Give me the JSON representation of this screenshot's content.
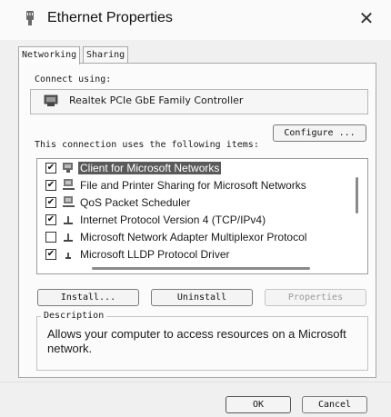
{
  "window": {
    "title": "Ethernet Properties",
    "close_glyph": "✕"
  },
  "tabs": [
    {
      "label": "Networking",
      "active": true
    },
    {
      "label": "Sharing",
      "active": false
    }
  ],
  "connect_using": {
    "label": "Connect using:",
    "adapter": "Realtek PCIe GbE Family Controller",
    "icon": "network-adapter-icon"
  },
  "buttons": {
    "configure": "Configure ...",
    "install": "Install...",
    "uninstall": "Uninstall",
    "properties": "Properties",
    "ok": "OK",
    "cancel": "Cancel"
  },
  "items_label": "This connection uses the following items:",
  "items": [
    {
      "label": "Client for Microsoft Networks",
      "checked": true,
      "selected": true,
      "icon": "network-client-icon"
    },
    {
      "label": "File and Printer Sharing for Microsoft Networks",
      "checked": true,
      "selected": false,
      "icon": "network-service-icon"
    },
    {
      "label": "QoS Packet Scheduler",
      "checked": true,
      "selected": false,
      "icon": "network-service-icon"
    },
    {
      "label": "Internet Protocol Version 4 (TCP/IPv4)",
      "checked": true,
      "selected": false,
      "icon": "protocol-icon"
    },
    {
      "label": "Microsoft Network Adapter Multiplexor Protocol",
      "checked": false,
      "selected": false,
      "icon": "protocol-icon"
    },
    {
      "label": "Microsoft LLDP Protocol Driver",
      "checked": true,
      "selected": false,
      "icon": "protocol-icon"
    }
  ],
  "description": {
    "legend": "Description",
    "text": "Allows your computer to access resources on a Microsoft network."
  }
}
